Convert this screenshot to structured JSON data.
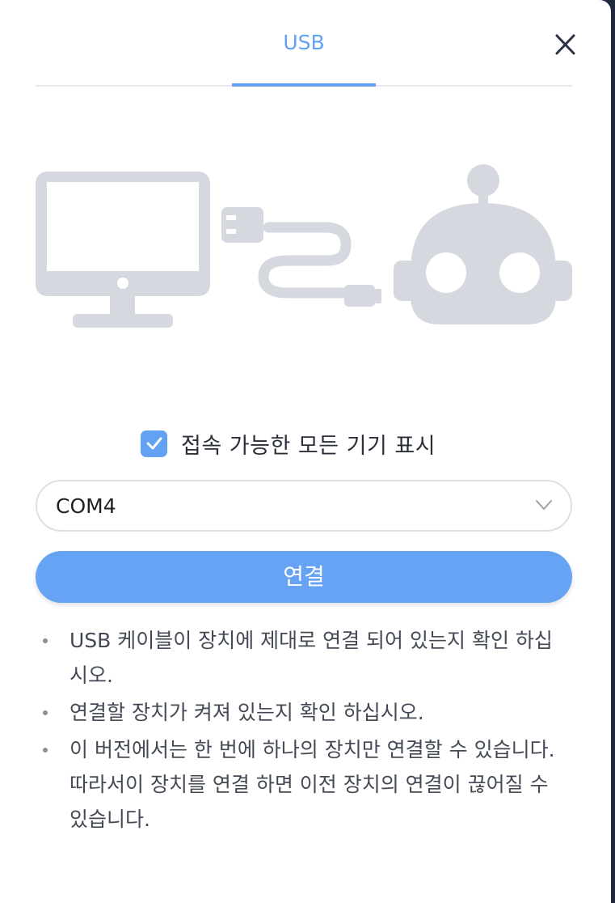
{
  "tab": {
    "label": "USB"
  },
  "icons": {
    "close": "close-icon",
    "check": "checkmark-icon",
    "chevron": "chevron-down-icon",
    "monitor": "monitor-icon",
    "cable": "usb-cable-icon",
    "robot": "robot-icon"
  },
  "colors": {
    "accent": "#62a1f3",
    "button": "#66a3f5",
    "illustration": "#d5d9df",
    "text": "#2a2f3a"
  },
  "show_all_devices": {
    "label": "접속 가능한 모든 기기 표시",
    "checked": true
  },
  "port_select": {
    "value": "COM4"
  },
  "connect_button": {
    "label": "연결"
  },
  "notes": [
    "USB 케이블이 장치에 제대로 연결 되어 있는지 확인 하십시오.",
    "연결할 장치가 켜져 있는지 확인 하십시오.",
    "이 버전에서는 한 번에 하나의 장치만 연결할 수 있습니다. 따라서이 장치를 연결 하면 이전 장치의 연결이 끊어질 수 있습니다."
  ]
}
